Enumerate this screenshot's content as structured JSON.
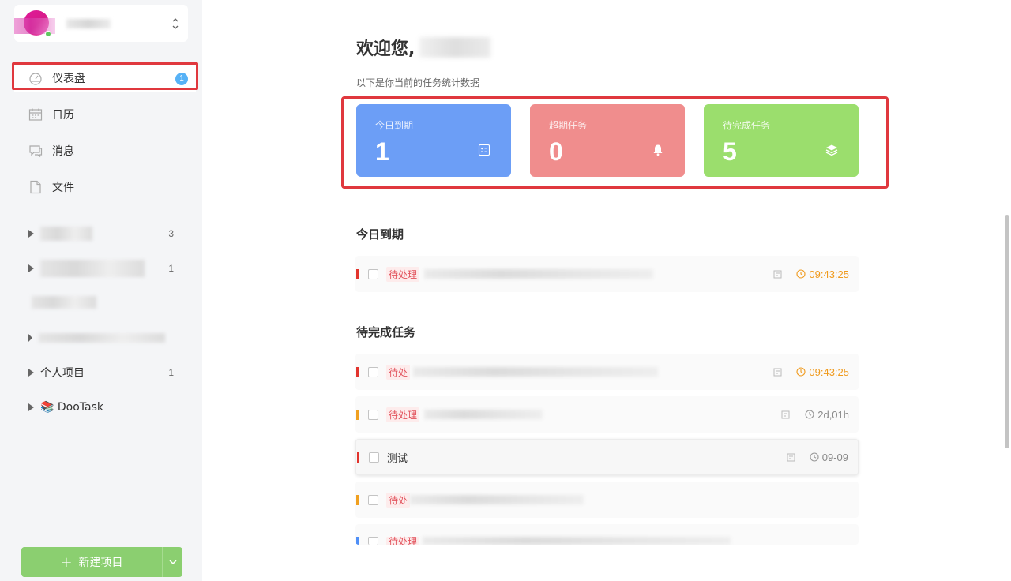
{
  "sidebar": {
    "nav": [
      {
        "label": "仪表盘",
        "badge": "1",
        "icon": "dashboard-icon"
      },
      {
        "label": "日历",
        "icon": "calendar-icon"
      },
      {
        "label": "消息",
        "icon": "message-icon"
      },
      {
        "label": "文件",
        "icon": "file-icon"
      }
    ],
    "projects": [
      {
        "count": "3"
      },
      {
        "count": "1"
      },
      {
        "count": ""
      },
      {
        "count": ""
      },
      {
        "label": "个人项目",
        "count": "1"
      },
      {
        "label": "📚 DooTask",
        "count": ""
      }
    ],
    "new_project_label": "新建项目"
  },
  "main": {
    "welcome": "欢迎您,",
    "subtitle": "以下是你当前的任务统计数据",
    "stats": [
      {
        "label": "今日到期",
        "value": "1",
        "color": "#6c9ef6",
        "icon": "checklist-icon"
      },
      {
        "label": "超期任务",
        "value": "0",
        "color": "#f08d8d",
        "icon": "bell-icon"
      },
      {
        "label": "待完成任务",
        "value": "5",
        "color": "#9bde6d",
        "icon": "layers-icon"
      }
    ],
    "today_section": {
      "title": "今日到期",
      "tasks": [
        {
          "tag": "待处理",
          "time": "09:43:25",
          "time_color": "#f09a1c",
          "flag_color": "#e2342d"
        }
      ]
    },
    "pending_section": {
      "title": "待完成任务",
      "tasks": [
        {
          "tag": "待处",
          "time": "09:43:25",
          "time_color": "#f09a1c",
          "flag_color": "#e2342d"
        },
        {
          "tag": "待处理",
          "time": "2d,01h",
          "time_color": "#888888",
          "flag_color": "#f0a020"
        },
        {
          "title": "测试",
          "time": "09-09",
          "time_color": "#888888",
          "flag_color": "#e2342d"
        },
        {
          "tag": "待处",
          "flag_color": "#f0a020"
        },
        {
          "tag": "待处理",
          "flag_color": "#4f8ff7"
        }
      ]
    }
  },
  "colors": {
    "highlight_border": "#e0383e",
    "sidebar_bg": "#f4f5f7",
    "new_project_bg": "#8bcf70",
    "badge_bg": "#57b2f6"
  }
}
